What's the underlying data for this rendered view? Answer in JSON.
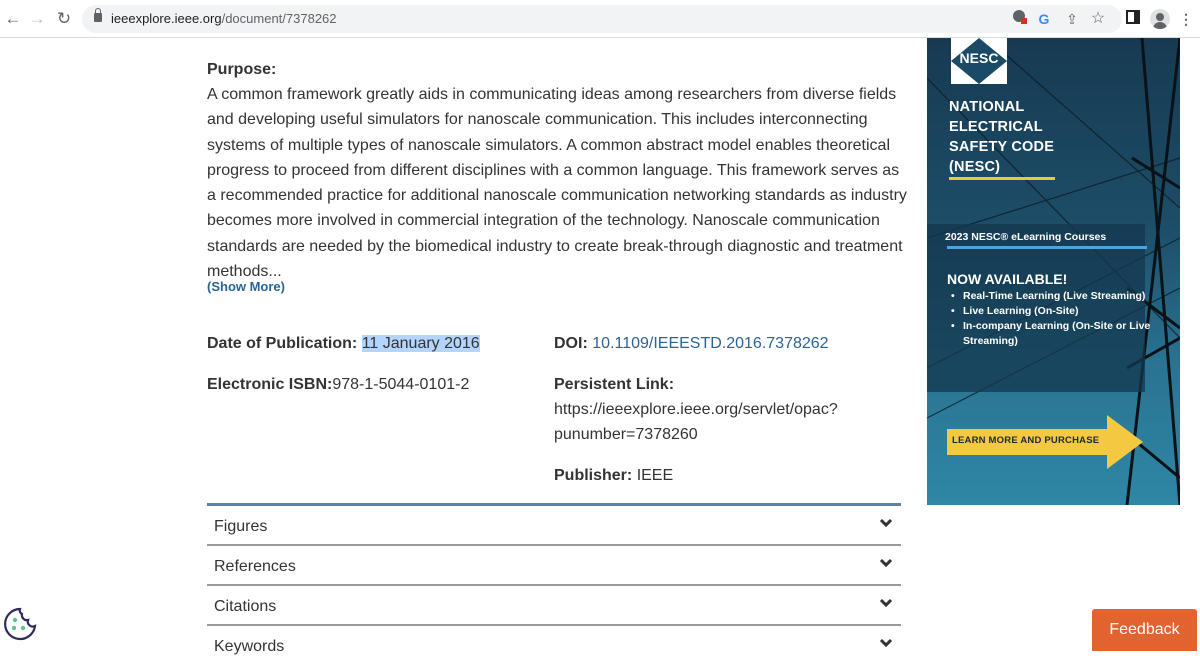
{
  "browser": {
    "url_host": "ieeexplore.ieee.org",
    "url_path": "/document/7378262",
    "icons": [
      "back-icon",
      "forward-icon",
      "reload-icon",
      "lock-icon",
      "extension-icon",
      "google-icon",
      "share-icon",
      "bookmark-star-icon",
      "side-panel-icon",
      "profile-icon",
      "menu-icon"
    ],
    "glyphs": {
      "back": "←",
      "forward": "→",
      "reload": "↻",
      "share": "⇪",
      "star": "☆",
      "menu": "⋮",
      "google": "G"
    }
  },
  "abstract": {
    "heading": "Purpose:",
    "text": "A common framework greatly aids in communicating ideas among researchers from diverse fields and developing useful simulators for nanoscale communication. This includes interconnecting systems of multiple types of nanoscale simulators. A common abstract model enables theoretical progress to proceed from different disciplines with a common language. This framework serves as a recommended practice for additional nanoscale communication networking standards as industry becomes more involved in commercial integration of the technology. Nanoscale communication standards are needed by the biomedical industry to create break-through diagnostic and treatment methods...",
    "show_more": "(Show More)"
  },
  "metadata": {
    "date_label": "Date of Publication:",
    "date_value": "11 January 2016",
    "isbn_label": "Electronic ISBN:",
    "isbn_value": "978-1-5044-0101-2",
    "doi_label": "DOI:",
    "doi_value": "10.1109/IEEESTD.2016.7378262",
    "persistent_label": "Persistent Link:",
    "persistent_line1": "https://ieeexplore.ieee.org/servlet/opac?",
    "persistent_line2": "punumber=7378260",
    "publisher_label": "Publisher:",
    "publisher_value": "IEEE"
  },
  "accordion": [
    {
      "label": "Figures"
    },
    {
      "label": "References"
    },
    {
      "label": "Citations"
    },
    {
      "label": "Keywords"
    }
  ],
  "ad": {
    "logo_text": "NESC",
    "title_lines": [
      "NATIONAL",
      "ELECTRICAL",
      "SAFETY CODE",
      "(NESC)"
    ],
    "courses": "2023 NESC® eLearning Courses",
    "now_available": "NOW AVAILABLE!",
    "items": [
      "Real-Time Learning (Live Streaming)",
      "Live Learning (On-Site)",
      "In-company Learning (On-Site or Live Streaming)"
    ],
    "cta": "LEARN MORE AND PURCHASE"
  },
  "feedback": "Feedback",
  "colors": {
    "link": "#2a6496",
    "feedback": "#e06330",
    "highlight": "#b3d4fc",
    "ad_yellow": "#f5c842"
  }
}
